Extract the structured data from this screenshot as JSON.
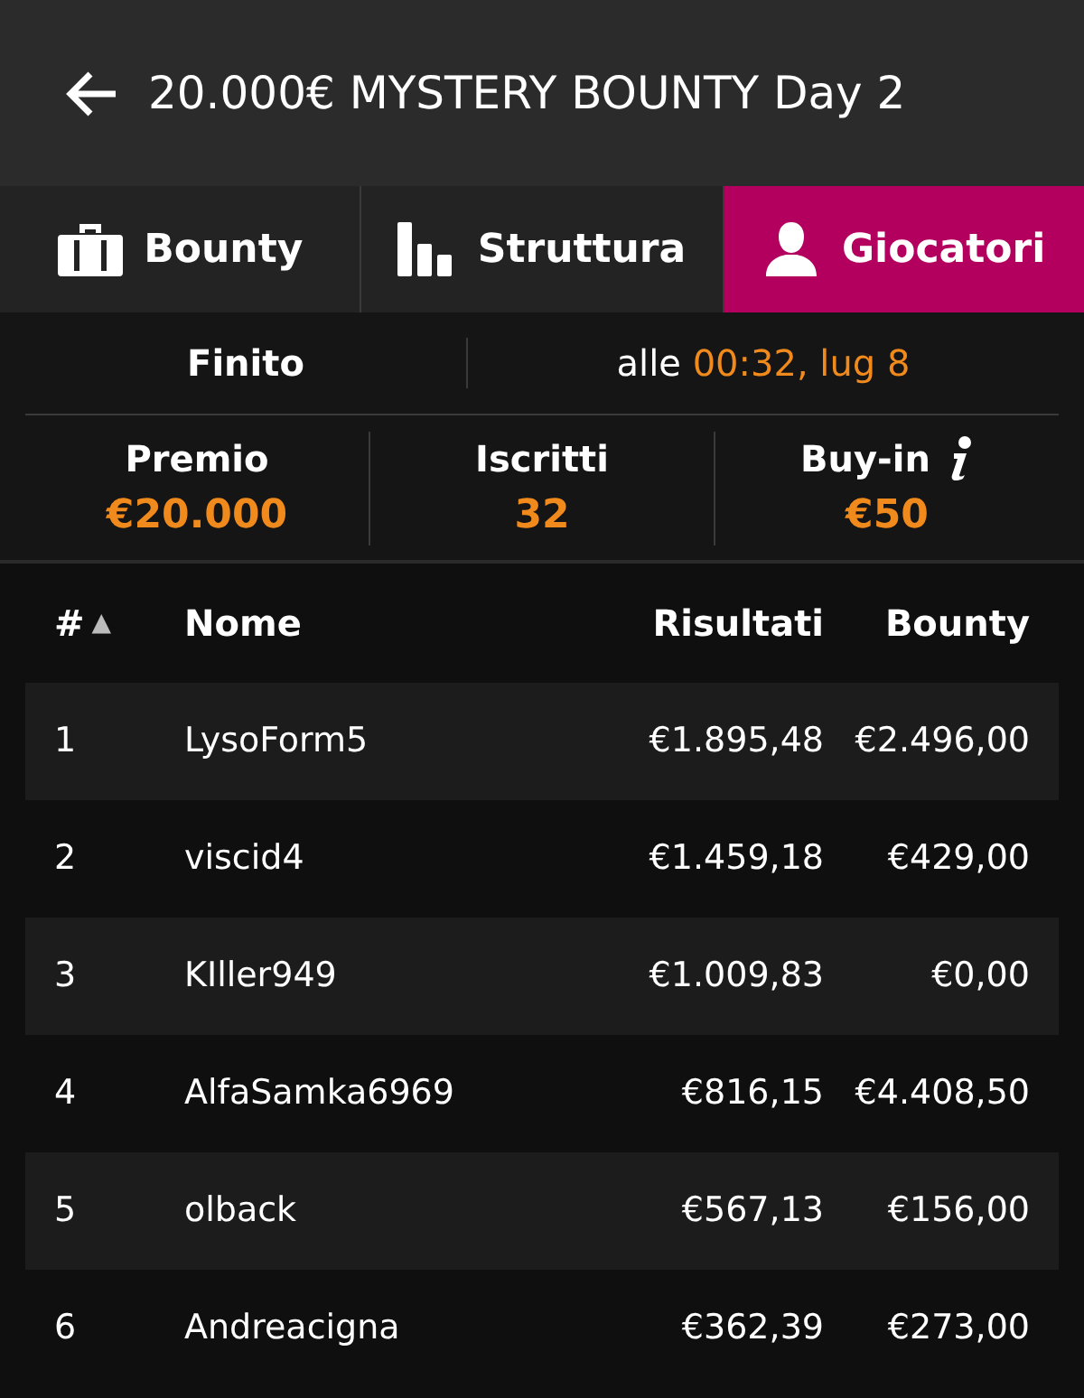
{
  "header": {
    "title": "20.000€ MYSTERY BOUNTY Day 2"
  },
  "tabs": [
    {
      "label": "Bounty",
      "selected": false
    },
    {
      "label": "Struttura",
      "selected": false
    },
    {
      "label": "Giocatori",
      "selected": true
    }
  ],
  "status": {
    "label": "Finito",
    "prefix": "alle",
    "time": "00:32, lug 8"
  },
  "stats": [
    {
      "label": "Premio",
      "value": "€20.000",
      "info": false
    },
    {
      "label": "Iscritti",
      "value": "32",
      "info": false
    },
    {
      "label": "Buy-in",
      "value": "€50",
      "info": true
    }
  ],
  "table": {
    "columns": [
      "#",
      "Nome",
      "Risultati",
      "Bounty"
    ],
    "sort_indicator": "▲",
    "rows": [
      [
        "1",
        "LysoForm5",
        "€1.895,48",
        "€2.496,00"
      ],
      [
        "2",
        "viscid4",
        "€1.459,18",
        "€429,00"
      ],
      [
        "3",
        "KIller949",
        "€1.009,83",
        "€0,00"
      ],
      [
        "4",
        "AlfaSamka6969",
        "€816,15",
        "€4.408,50"
      ],
      [
        "5",
        "olback",
        "€567,13",
        "€156,00"
      ],
      [
        "6",
        "Andreacigna",
        "€362,39",
        "€273,00"
      ]
    ]
  }
}
